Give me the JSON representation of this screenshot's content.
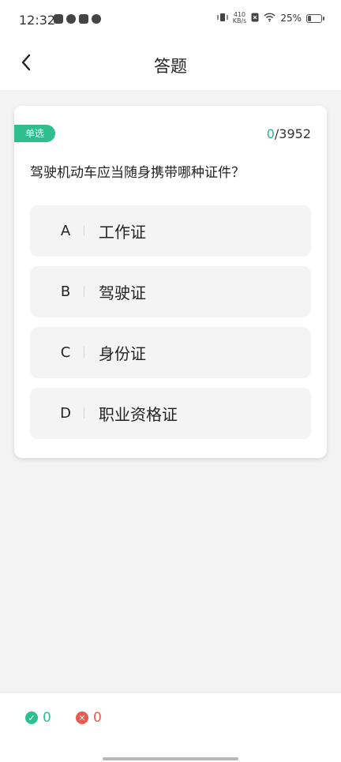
{
  "status": {
    "time": "12:32",
    "net_speed_value": "410",
    "net_speed_unit": "KB/s",
    "battery": "25%"
  },
  "header": {
    "title": "答题"
  },
  "question": {
    "type": "单选",
    "progress_current": "0",
    "progress_total": "/3952",
    "text": "驾驶机动车应当随身携带哪种证件？",
    "options": [
      {
        "letter": "A",
        "text": "工作证"
      },
      {
        "letter": "B",
        "text": "驾驶证"
      },
      {
        "letter": "C",
        "text": "身份证"
      },
      {
        "letter": "D",
        "text": "职业资格证"
      }
    ]
  },
  "footer": {
    "correct_count": "0",
    "wrong_count": "0"
  },
  "colors": {
    "accent": "#2fbf8f",
    "wrong": "#e85a4f"
  },
  "icons": {
    "back": "chevron-left-icon",
    "correct": "check-circle-icon",
    "wrong": "x-circle-icon"
  }
}
